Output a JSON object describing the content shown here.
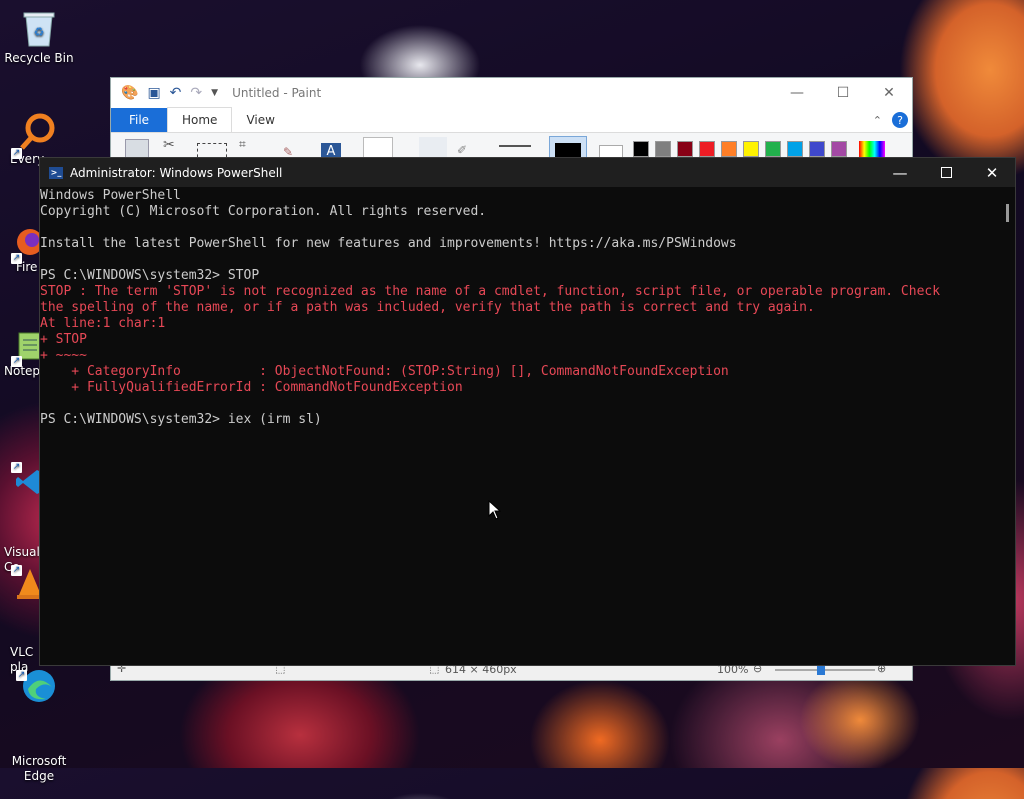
{
  "desktop": {
    "icons": [
      {
        "label": "Recycle Bin"
      },
      {
        "label": "Every"
      },
      {
        "label": "Fire"
      },
      {
        "label": "Notep"
      },
      {
        "label": "Visual\nCo"
      },
      {
        "label": "VLC\npla"
      },
      {
        "label": "Microsoft\nEdge"
      }
    ]
  },
  "paint": {
    "title": "Untitled - Paint",
    "tabs": {
      "file": "File",
      "home": "Home",
      "view": "View"
    },
    "status_size": "614 × 460px",
    "status_zoom": "100%",
    "palette": [
      "#000000",
      "#7f7f7f",
      "#880015",
      "#ed1c24",
      "#ff7f27",
      "#fff200",
      "#22b14c",
      "#00a2e8",
      "#3f48cc",
      "#a349a4"
    ]
  },
  "powershell": {
    "title": "Administrator: Windows PowerShell",
    "lines": [
      {
        "text": "Windows PowerShell",
        "type": "normal"
      },
      {
        "text": "Copyright (C) Microsoft Corporation. All rights reserved.",
        "type": "normal"
      },
      {
        "text": "",
        "type": "normal"
      },
      {
        "text": "Install the latest PowerShell for new features and improvements! https://aka.ms/PSWindows",
        "type": "normal"
      },
      {
        "text": "",
        "type": "normal"
      },
      {
        "text": "PS C:\\WINDOWS\\system32> STOP",
        "type": "normal"
      },
      {
        "text": "STOP : The term 'STOP' is not recognized as the name of a cmdlet, function, script file, or operable program. Check",
        "type": "error"
      },
      {
        "text": "the spelling of the name, or if a path was included, verify that the path is correct and try again.",
        "type": "error"
      },
      {
        "text": "At line:1 char:1",
        "type": "error"
      },
      {
        "text": "+ STOP",
        "type": "error"
      },
      {
        "text": "+ ~~~~",
        "type": "error"
      },
      {
        "text": "    + CategoryInfo          : ObjectNotFound: (STOP:String) [], CommandNotFoundException",
        "type": "error"
      },
      {
        "text": "    + FullyQualifiedErrorId : CommandNotFoundException",
        "type": "error"
      },
      {
        "text": "",
        "type": "normal"
      },
      {
        "text": "PS C:\\WINDOWS\\system32> iex (irm sl)",
        "type": "normal"
      }
    ]
  }
}
